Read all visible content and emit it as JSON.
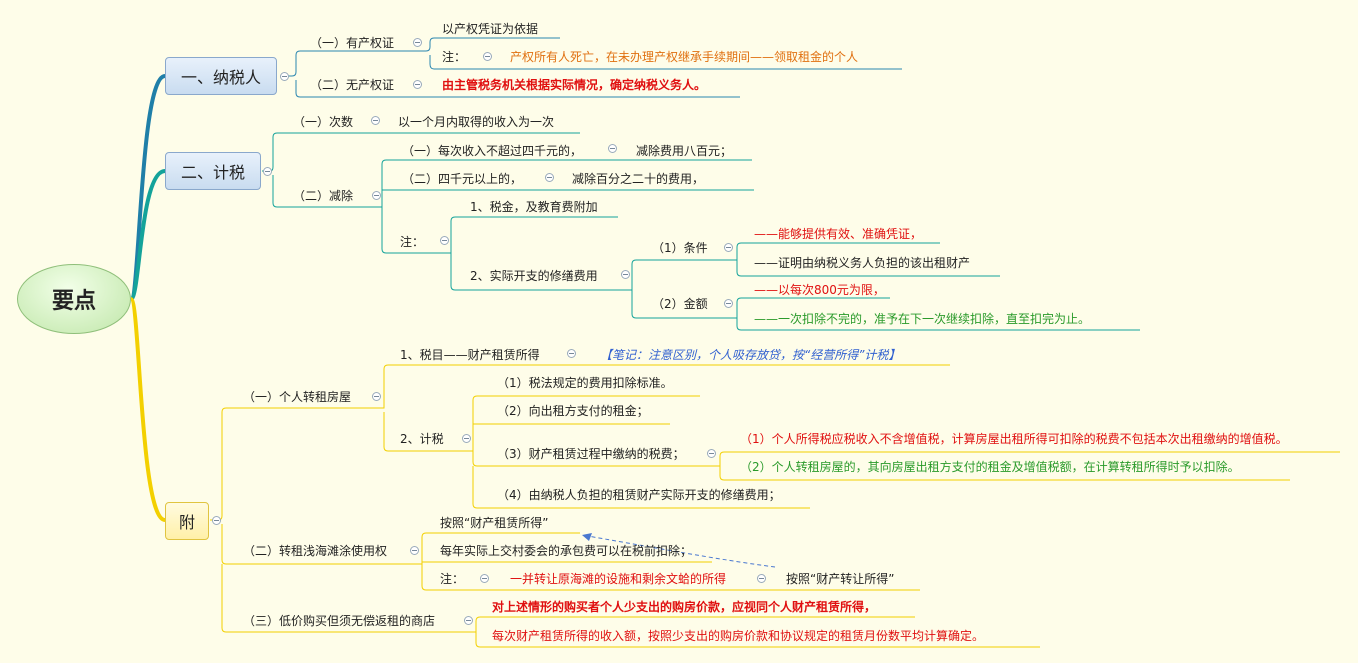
{
  "root": "要点",
  "branch1": {
    "title": "一、纳税人",
    "cert": "（一）有产权证",
    "cert_basis": "以产权凭证为依据",
    "cert_note_label": "注：",
    "cert_note": "产权所有人死亡，在未办理产权继承手续期间——领取租金的个人",
    "nocert": "（二）无产权证",
    "nocert_text": "由主管税务机关根据实际情况，确定纳税义务人。"
  },
  "branch2": {
    "title": "二、计税",
    "times": "（一）次数",
    "times_text": "以一个月内取得的收入为一次",
    "deduct": "（二）减除",
    "d1": "（一）每次收入不超过四千元的，",
    "d1_text": "减除费用八百元；",
    "d2": "（二）四千元以上的，",
    "d2_text": "减除百分之二十的费用，",
    "note_label": "注：",
    "n1": "1、税金，及教育费附加",
    "n2": "2、实际开支的修缮费用",
    "cond": "（1）条件",
    "cond1": "——能够提供有效、准确凭证，",
    "cond2": "——证明由纳税义务人负担的该出租财产",
    "amount": "（2）金额",
    "amt1": "——以每次800元为限，",
    "amt2": "——一次扣除不完的，准予在下一次继续扣除，直至扣完为止。"
  },
  "branch3": {
    "title": "附",
    "sub1": "（一）个人转租房屋",
    "item1": "1、税目——财产租赁所得",
    "item1_note": "【笔记：注意区别，个人吸存放贷，按“经营所得”计税】",
    "item2": "2、计税",
    "c1": "（1）税法规定的费用扣除标准。",
    "c2": "（2）向出租方支付的租金；",
    "c3": "（3）财产租赁过程中缴纳的税费；",
    "c3a": "（1）个人所得税应税收入不含增值税，计算房屋出租所得可扣除的税费不包括本次出租缴纳的增值税。",
    "c3b": "（2）个人转租房屋的，其向房屋出租方支付的租金及增值税额，在计算转租所得时予以扣除。",
    "c4": "（4）由纳税人负担的租赁财产实际开支的修缮费用；",
    "sub2": "（二）转租浅海滩涂使用权",
    "s2a": "按照“财产租赁所得”",
    "s2b": "每年实际上交村委会的承包费可以在税前扣除；",
    "s2_note_label": "注：",
    "s2_note": "一并转让原海滩的设施和剩余文蛤的所得",
    "s2_note_result": "按照“财产转让所得”",
    "sub3": "（三）低价购买但须无偿返租的商店",
    "s3a": "对上述情形的购买者个人少支出的购房价款，应视同个人财产租赁所得，",
    "s3b": "每次财产租赁所得的收入额，按照少支出的购房价款和协议规定的租赁月份数平均计算确定。"
  },
  "colors": {
    "trunk_blue": "#1f7fa8",
    "trunk_teal": "#14a39a",
    "trunk_yellow": "#f3d000"
  }
}
